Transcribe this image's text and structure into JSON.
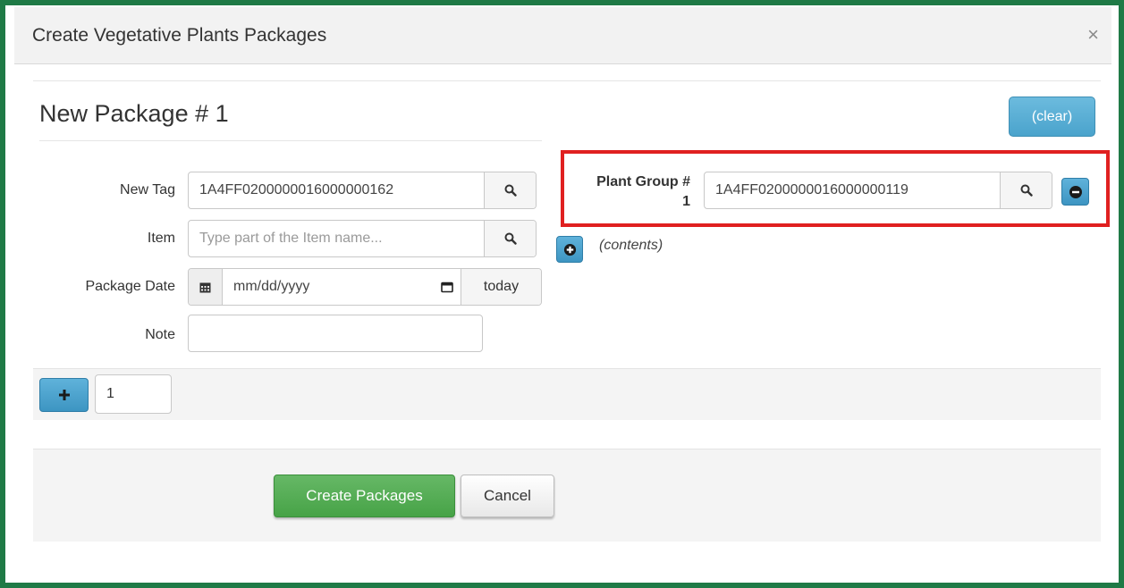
{
  "modal": {
    "title": "Create Vegetative Plants Packages",
    "close_symbol": "×"
  },
  "package": {
    "title": "New Package # 1",
    "clear_label": "(clear)",
    "fields": {
      "new_tag": {
        "label": "New Tag",
        "value": "1A4FF0200000016000000162"
      },
      "item": {
        "label": "Item",
        "placeholder": "Type part of the Item name..."
      },
      "package_date": {
        "label": "Package Date",
        "placeholder": "mm/dd/yyyy",
        "today_label": "today"
      },
      "note": {
        "label": "Note",
        "value": ""
      }
    }
  },
  "plant_group": {
    "label_line1": "Plant Group #",
    "label_line2": "1",
    "value": "1A4FF0200000016000000119",
    "contents_label": "(contents)"
  },
  "add_row": {
    "count": "1"
  },
  "actions": {
    "create_label": "Create Packages",
    "cancel_label": "Cancel"
  },
  "icons": [
    "search-icon",
    "calendar-icon",
    "date-picker-icon",
    "minus-circle-icon",
    "plus-circle-icon",
    "plus-icon",
    "close-icon"
  ],
  "colors": {
    "frame": "#1f7a46",
    "primary_blue": "#4aa3cc",
    "success_green": "#47a347",
    "highlight_red": "#e02020"
  }
}
